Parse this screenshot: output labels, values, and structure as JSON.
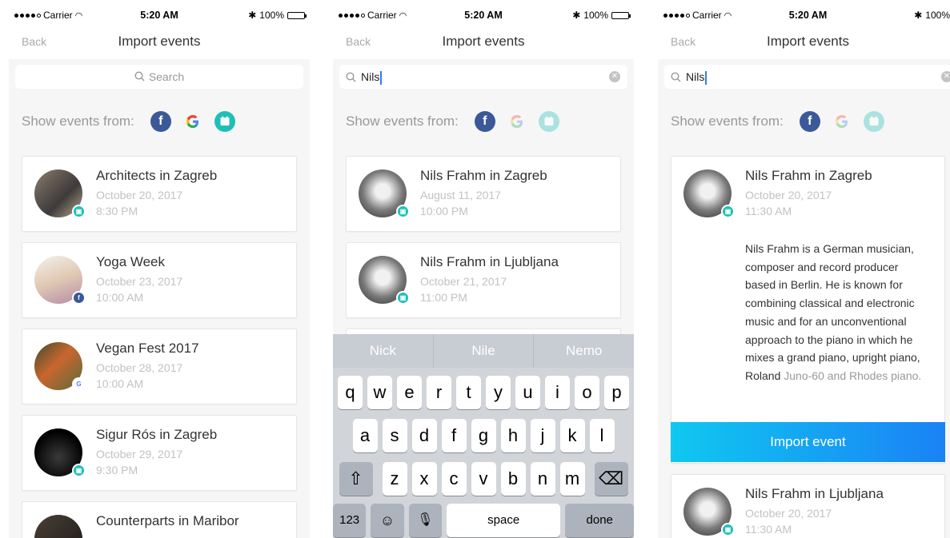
{
  "status": {
    "carrier": "Carrier",
    "time": "5:20 AM",
    "battery": "100%"
  },
  "nav": {
    "back": "Back",
    "title": "Import events"
  },
  "search": {
    "placeholder": "Search",
    "query": "Nils"
  },
  "filter": {
    "label": "Show events from:"
  },
  "screen1": {
    "events": [
      {
        "title": "Architects in Zagreb",
        "date": "October 20, 2017",
        "time": "8:30 PM",
        "source": "calendar"
      },
      {
        "title": "Yoga Week",
        "date": "October 23, 2017",
        "time": "10:00 AM",
        "source": "facebook"
      },
      {
        "title": "Vegan Fest 2017",
        "date": "October 28, 2017",
        "time": "10:00 AM",
        "source": "google"
      },
      {
        "title": "Sigur Rós in Zagreb",
        "date": "October 29, 2017",
        "time": "9:30 PM",
        "source": "calendar"
      },
      {
        "title": "Counterparts in Maribor"
      }
    ]
  },
  "screen2": {
    "events": [
      {
        "title": "Nils Frahm in Zagreb",
        "date": "August 11, 2017",
        "time": "10:00 PM",
        "source": "calendar"
      },
      {
        "title": "Nils Frahm in Ljubljana",
        "date": "October 21, 2017",
        "time": "11:00 PM",
        "source": "calendar"
      }
    ],
    "keyboard": {
      "suggestions": [
        "Nick",
        "Nile",
        "Nemo"
      ],
      "row1": [
        "q",
        "w",
        "e",
        "r",
        "t",
        "y",
        "u",
        "i",
        "o",
        "p"
      ],
      "row2": [
        "a",
        "s",
        "d",
        "f",
        "g",
        "h",
        "j",
        "k",
        "l"
      ],
      "row3": [
        "z",
        "x",
        "c",
        "v",
        "b",
        "n",
        "m"
      ],
      "num": "123",
      "space": "space",
      "done": "done"
    }
  },
  "screen3": {
    "expanded": {
      "title": "Nils Frahm in Zagreb",
      "date": "October 20, 2017",
      "time": "11:30 AM",
      "description": "Nils Frahm is a German musician, composer and record producer based in Berlin. He is known for combining classical and electronic music and for an unconventional approach to the piano in which he mixes a grand piano, upright piano, Roland",
      "description_fade": "Juno-60 and Rhodes piano.",
      "button": "Import event"
    },
    "next": {
      "title": "Nils Frahm in Ljubljana",
      "date": "October 20, 2017",
      "time": "11:30 AM",
      "source": "calendar"
    }
  },
  "colors": {
    "facebook": "#3b5998",
    "calendar": "#1fbfb8",
    "accent_start": "#10c8f0",
    "accent_end": "#1a82f5"
  }
}
